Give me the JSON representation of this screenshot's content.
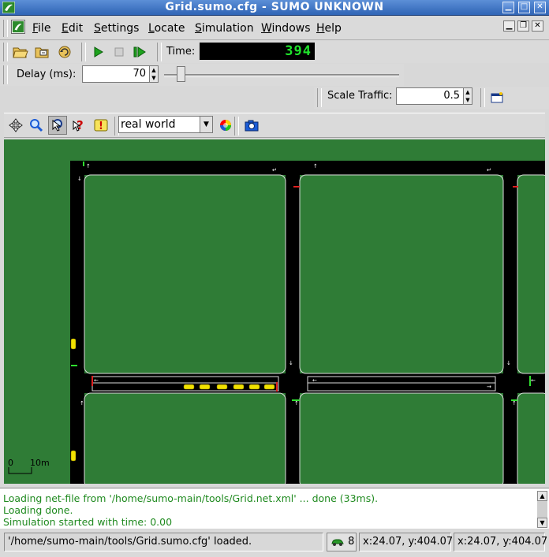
{
  "window": {
    "title": "Grid.sumo.cfg - SUMO UNKNOWN",
    "buttons": [
      "▁",
      "□",
      "✕"
    ]
  },
  "menu": {
    "items": [
      "File",
      "Edit",
      "Settings",
      "Locate",
      "Simulation",
      "Windows",
      "Help"
    ]
  },
  "toolbar": {
    "time_label": "Time:",
    "time_value": "394",
    "delay_label": "Delay (ms):",
    "delay_value": "70",
    "delay_slider": 0.07,
    "scale_label": "Scale Traffic:",
    "scale_value": "0.5"
  },
  "view_toolbar": {
    "scheme": "real world"
  },
  "view": {
    "scale_zero": "0",
    "scale_label": "10m",
    "colors": {
      "grass": "#2f7c36",
      "road": "#000000",
      "block": "#2f7c36",
      "vehicle": "#f2e200"
    }
  },
  "messages": [
    "Loading net-file from '/home/sumo-main/tools/Grid.net.xml' ... done (33ms).",
    "Loading done.",
    "Simulation started with time: 0.00"
  ],
  "status": {
    "text": "'/home/sumo-main/tools/Grid.sumo.cfg' loaded.",
    "vehicle_count": "8",
    "coord1": "x:24.07, y:404.07",
    "coord2": "x:24.07, y:404.07"
  }
}
